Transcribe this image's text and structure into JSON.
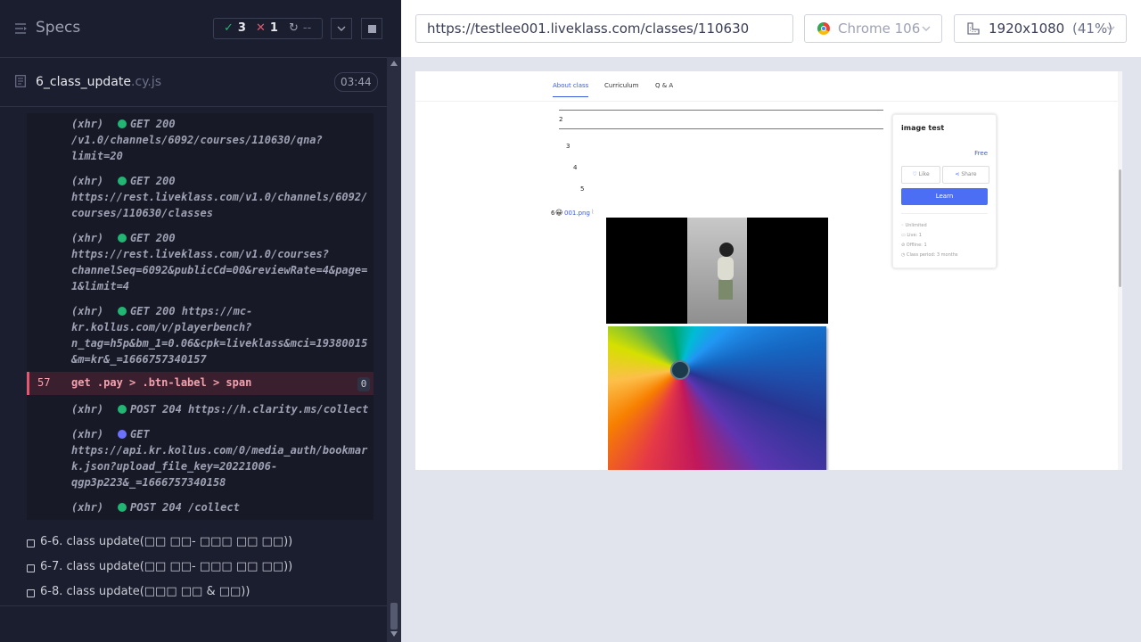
{
  "header": {
    "title": "Specs",
    "passed": "3",
    "failed": "1",
    "pending": "--"
  },
  "file": {
    "name": "6_class_update",
    "ext": ".cy.js",
    "duration": "03:44"
  },
  "commands": [
    {
      "type": "(xhr)",
      "dot": "#22b573",
      "text": "GET 200\n/v1.0/channels/6092/courses/110630/qna?\nlimit=20"
    },
    {
      "type": "(xhr)",
      "dot": "#22b573",
      "text": "GET 200\nhttps://rest.liveklass.com/v1.0/channels/6092/\ncourses/110630/classes"
    },
    {
      "type": "(xhr)",
      "dot": "#22b573",
      "text": "GET 200\nhttps://rest.liveklass.com/v1.0/courses?\nchannelSeq=6092&publicCd=00&reviewRate=4&page=\n1&limit=4"
    },
    {
      "type": "(xhr)",
      "dot": "#22b573",
      "text": "GET 200 https://mc-\nkr.kollus.com/v/playerbench?\nn_tag=h5p&bm_1=0.06&cpk=liveklass&mci=19380015\n&m=kr&_=1666757340157"
    },
    {
      "type": "(xhr)",
      "dot": "#22b573",
      "text": "POST 204 https://h.clarity.ms/collect"
    },
    {
      "type": "(xhr)",
      "dot": "#6c72ff",
      "text": "GET\nhttps://api.kr.kollus.com/0/media_auth/bookmar\nk.json?upload_file_key=20221006-\nqgp3p223&_=1666757340158"
    },
    {
      "type": "(xhr)",
      "dot": "#22b573",
      "text": "POST 204 /collect"
    }
  ],
  "failed_command": {
    "number": "57",
    "name": "get  .pay > .btn-label > span",
    "count": "0"
  },
  "tests": [
    "6-6. class update(□□ □□- □□□ □□ □□))",
    "6-7. class update(□□ □□- □□□ □□ □□))",
    "6-8. class update(□□□ □□ & □□))"
  ],
  "toolbar": {
    "url": "https://testlee001.liveklass.com/classes/110630",
    "browser": "Chrome 106",
    "viewport": "1920x1080",
    "zoom": "(41%)"
  },
  "aut": {
    "tabs": [
      "About class",
      "Curriculum",
      "Q & A"
    ],
    "list_numbers": [
      "2",
      "3",
      "4",
      "5",
      "6"
    ],
    "file_link": "001.png",
    "card": {
      "title": "image test",
      "price": "Free",
      "like": "Like",
      "share": "Share",
      "learn": "Learn",
      "meta": [
        "Unlimited",
        "Live: 1",
        "Offline: 1",
        "Class period: 3 months"
      ]
    }
  },
  "colors": {
    "pass": "#22b573",
    "fail": "#e45770",
    "accent": "#3b5bdb",
    "panel_bg": "#1b1e2e"
  }
}
